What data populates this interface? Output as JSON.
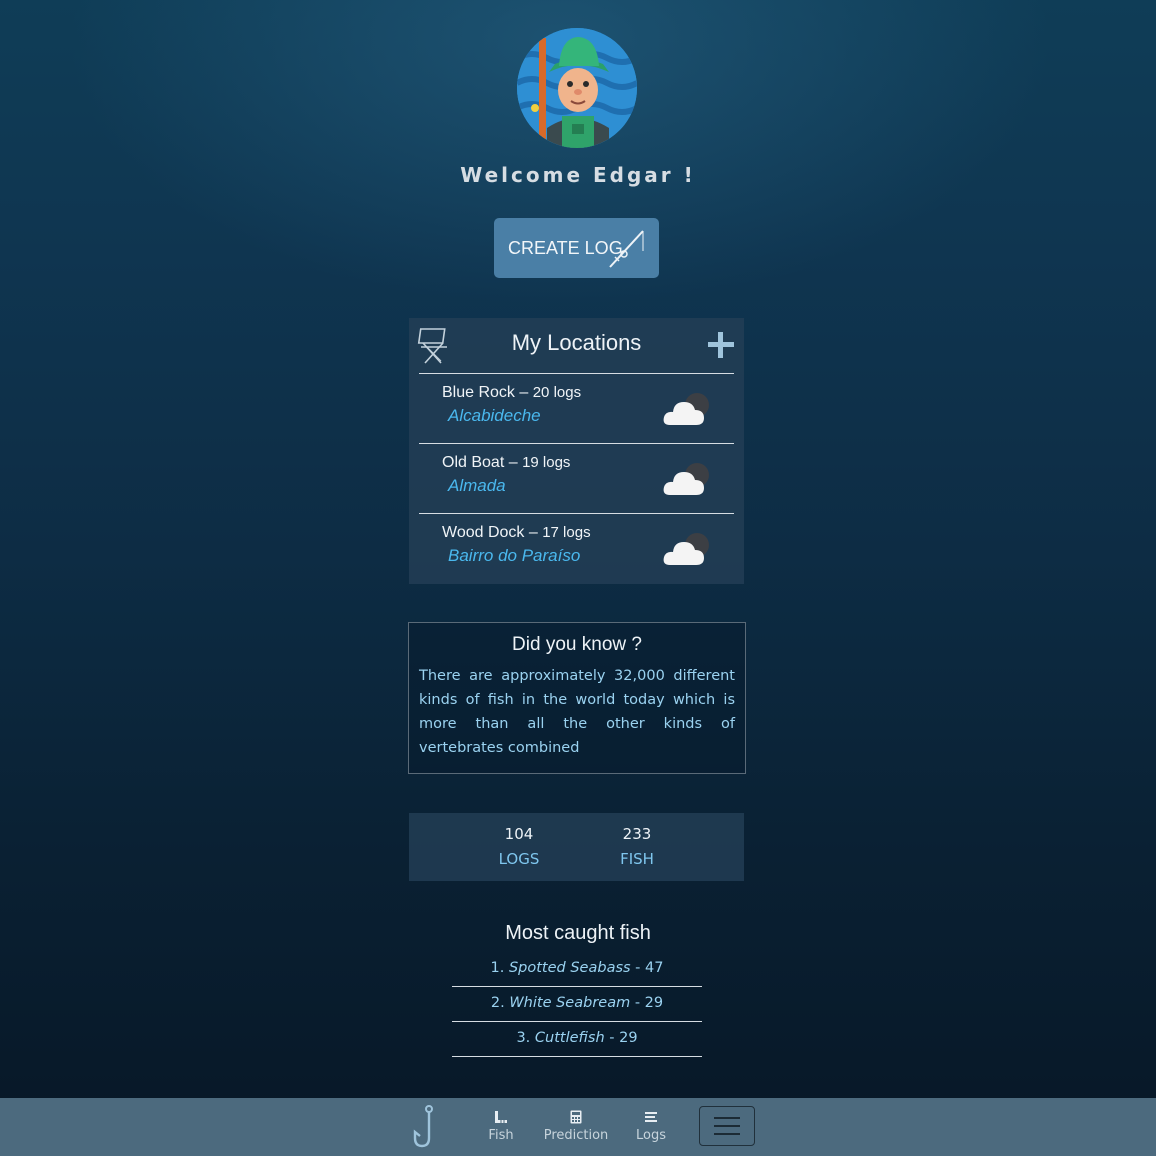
{
  "welcome": "Welcome Edgar !",
  "create_log": "CREATE LOG",
  "locations": {
    "title": "My Locations",
    "items": [
      {
        "name": "Blue Rock",
        "logs": "20 logs",
        "city": "Alcabideche"
      },
      {
        "name": "Old Boat",
        "logs": "19 logs",
        "city": "Almada"
      },
      {
        "name": "Wood Dock",
        "logs": "17 logs",
        "city": "Bairro do Paraíso"
      }
    ]
  },
  "did_you_know": {
    "title": "Did you know ?",
    "text": "There are approximately 32,000 different kinds of fish in the world today which is more than all the other kinds of vertebrates combined"
  },
  "stats": {
    "logs_value": "104",
    "logs_label": "LOGS",
    "fish_value": "233",
    "fish_label": "FISH"
  },
  "most_caught": {
    "title": "Most caught fish",
    "items": [
      {
        "rank": "1.",
        "name": "Spotted Seabass",
        "count": "- 47"
      },
      {
        "rank": "2.",
        "name": "White Seabream",
        "count": "- 29"
      },
      {
        "rank": "3.",
        "name": "Cuttlefish",
        "count": "- 29"
      }
    ]
  },
  "nav": {
    "fish": "Fish",
    "prediction": "Prediction",
    "logs": "Logs"
  },
  "colors": {
    "accent_button": "#4a7fa6",
    "link_blue": "#4ab8ee",
    "nav_bar": "#4c6a7e"
  }
}
